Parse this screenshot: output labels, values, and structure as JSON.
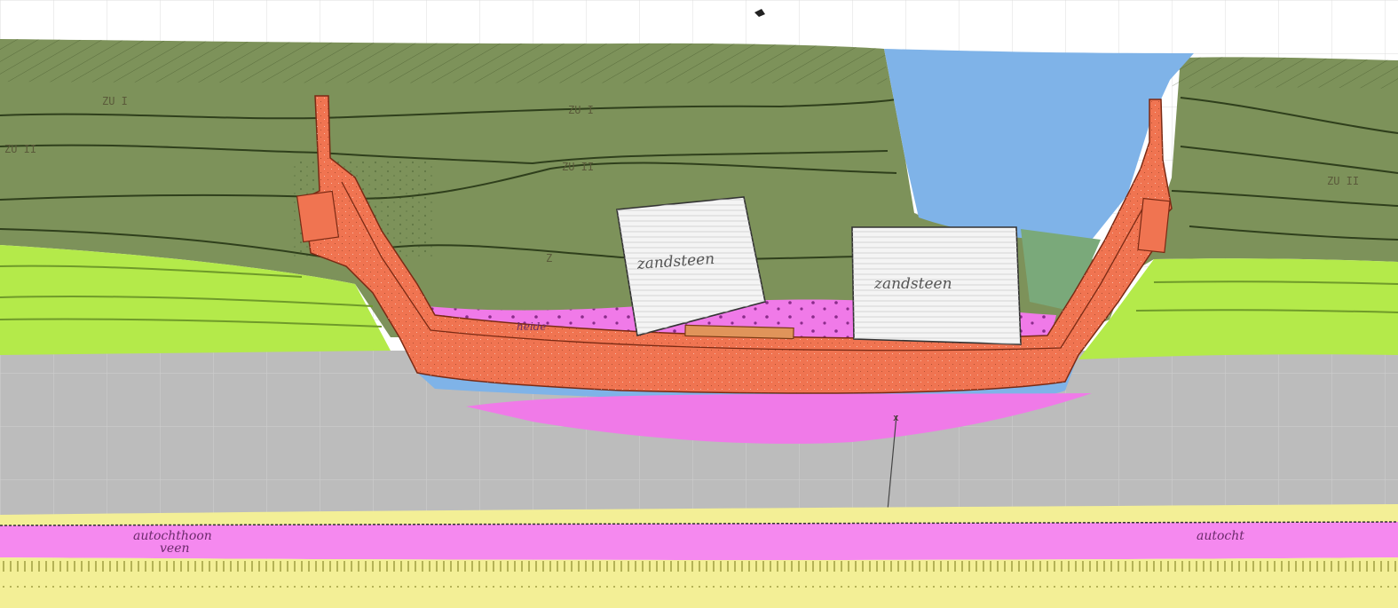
{
  "labels": {
    "zu_i_left": "ZU I",
    "zu_ii_left": "ZU II",
    "zu_i_mid": "ZU I",
    "zu_ii_mid": "ZU II",
    "zu_ii_right": "ZU II",
    "z_mid": "Z",
    "zandsteen_left": "zandsteen",
    "zandsteen_right": "zandsteen",
    "heide": "heide",
    "peat_left_line1": "autochthoon",
    "peat_left_line2": "veen",
    "peat_right": "autocht",
    "x_marker": "x"
  },
  "colors": {
    "sky": "#ffffff",
    "green_fill": "#7d925a",
    "lime": "#b4ea4a",
    "grey": "#bcbcbc",
    "blue": "#7fb3e8",
    "magenta": "#f07ae8",
    "pink_band": "#f589ef",
    "yellow": "#f3ef96",
    "orange": "#f07451",
    "teal_green": "#7aa97a",
    "stone": "#f4f4f4"
  }
}
